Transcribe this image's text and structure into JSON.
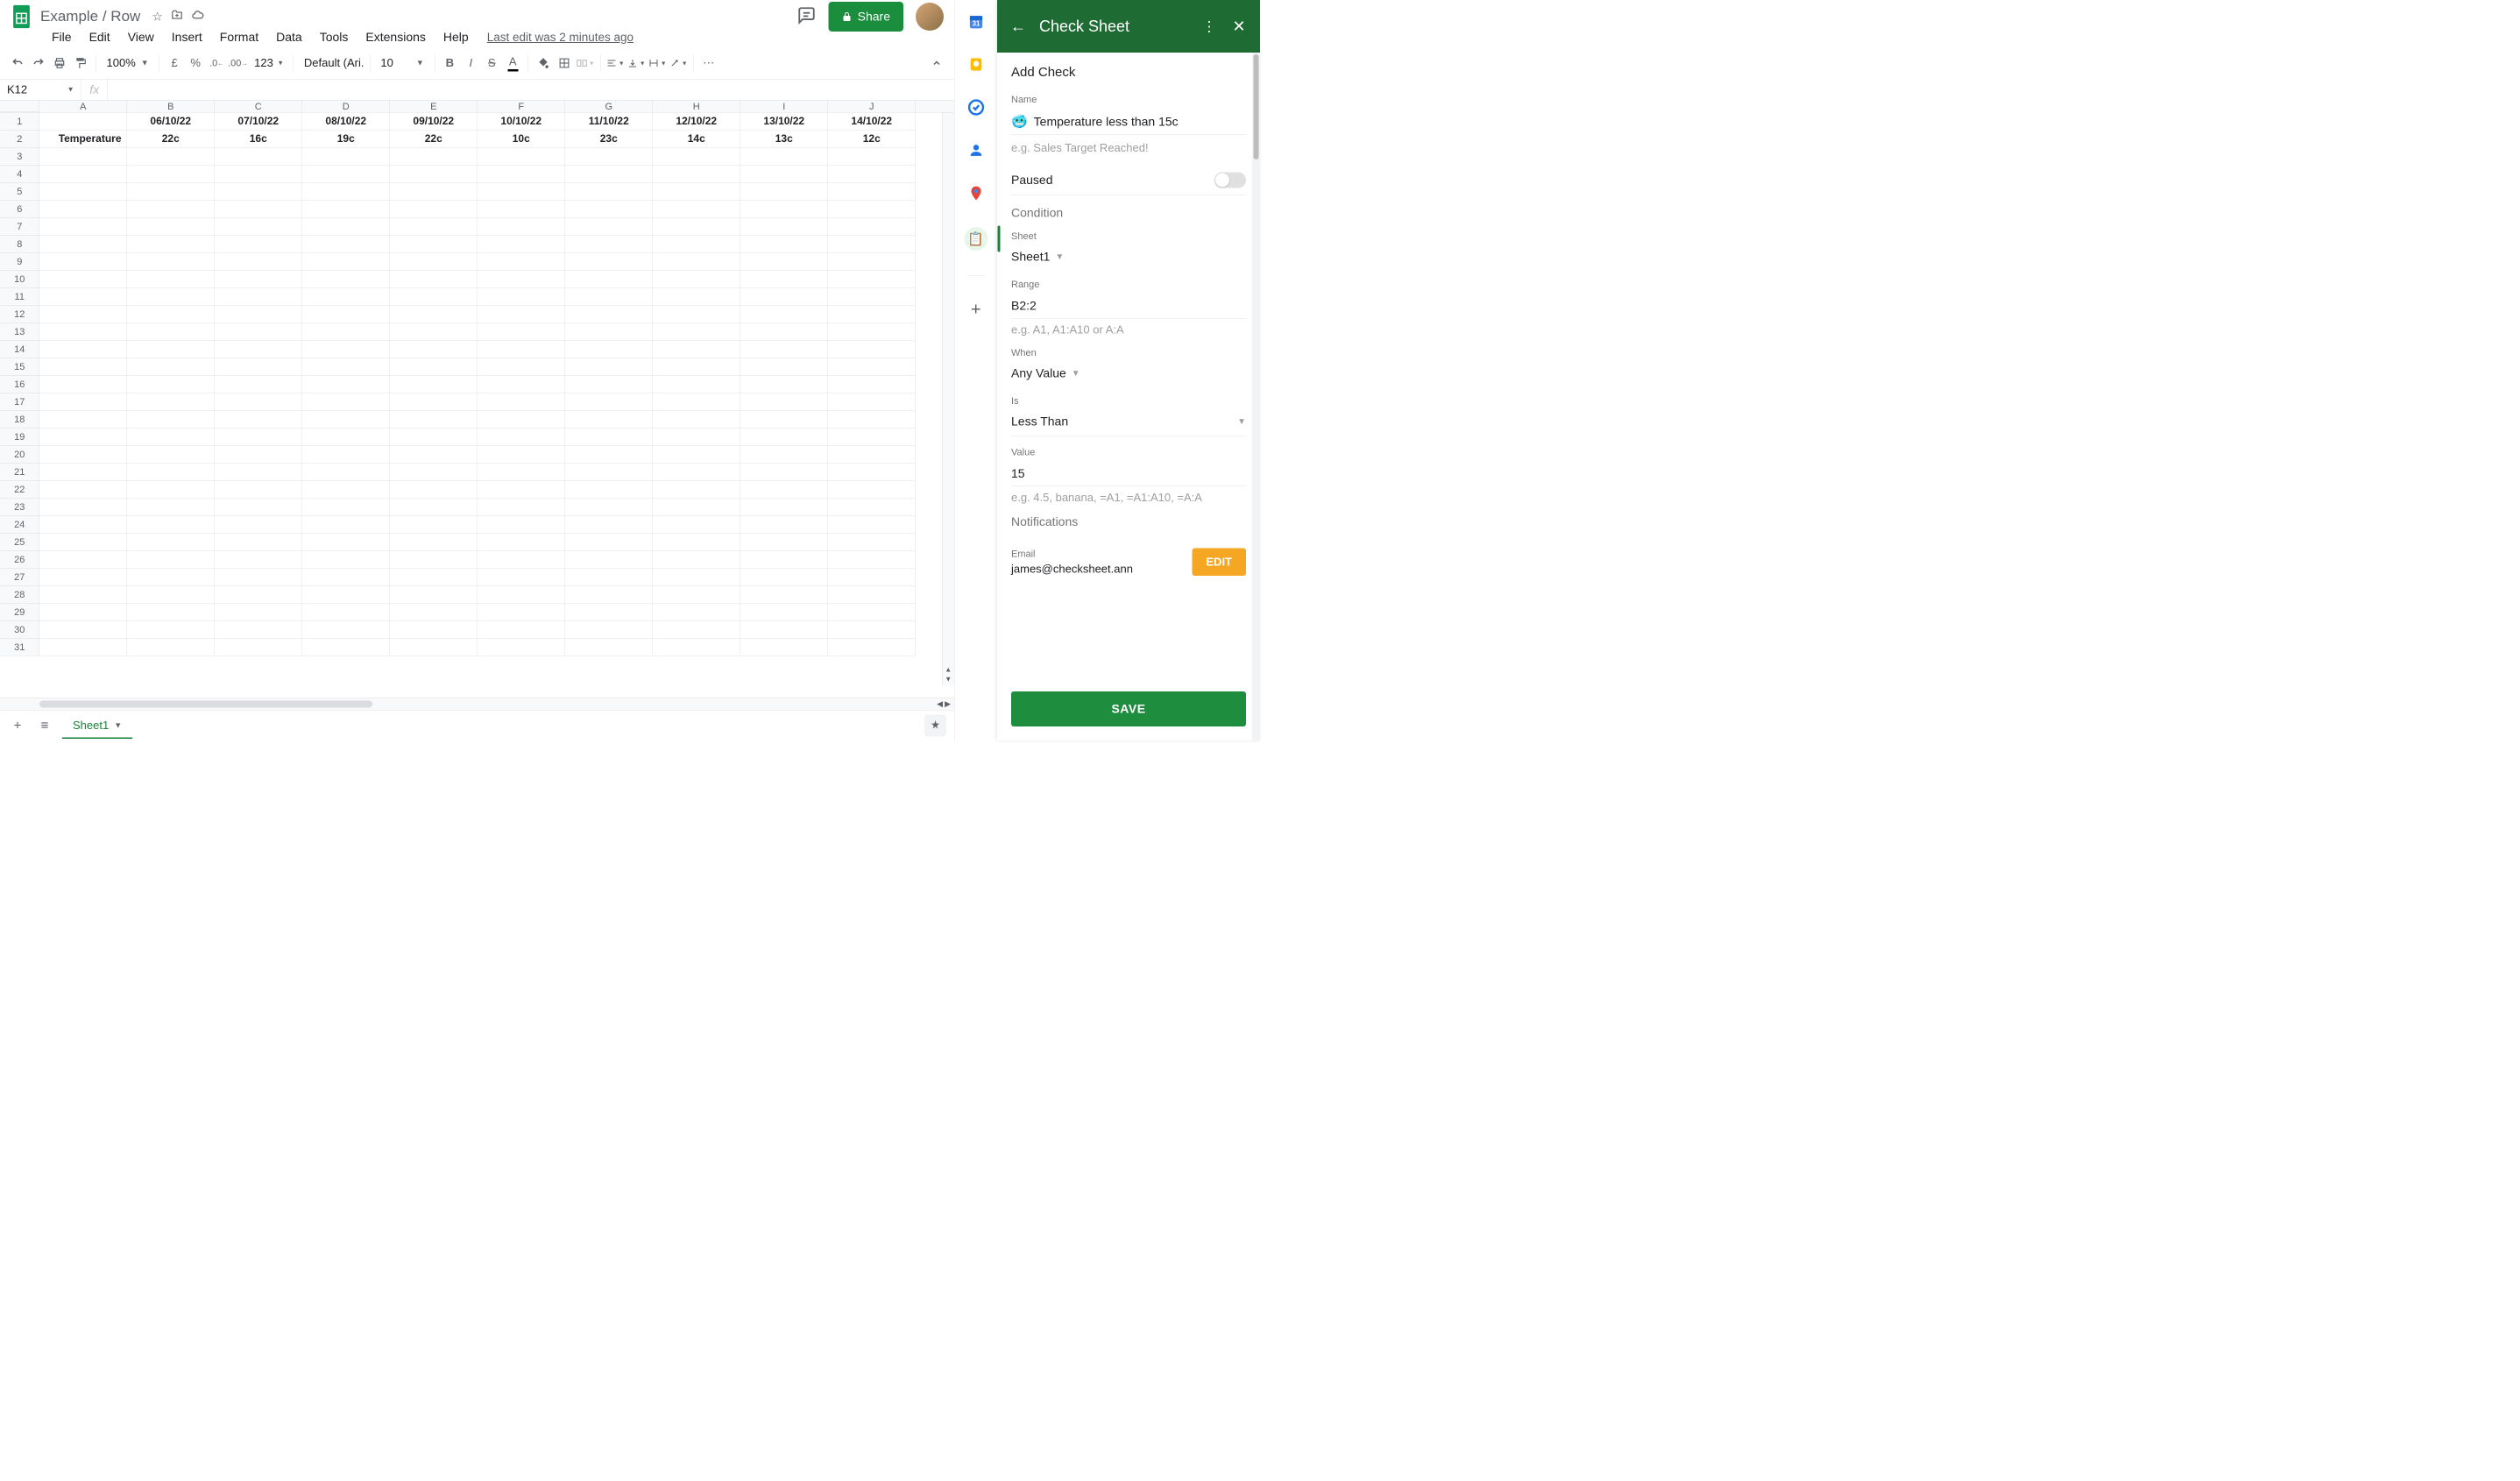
{
  "doc": {
    "title": "Example / Row",
    "last_edit": "Last edit was 2 minutes ago"
  },
  "menubar": [
    "File",
    "Edit",
    "View",
    "Insert",
    "Format",
    "Data",
    "Tools",
    "Extensions",
    "Help"
  ],
  "toolbar": {
    "zoom": "100%",
    "font": "Default (Ari...",
    "fontsize": "10",
    "currency": "£",
    "percent": "%",
    "dec_less": ".0",
    "dec_more": ".00",
    "num_format": "123"
  },
  "share_label": "Share",
  "namebox": "K12",
  "fx_value": "",
  "columns": [
    "A",
    "B",
    "C",
    "D",
    "E",
    "F",
    "G",
    "H",
    "I",
    "J"
  ],
  "rows": 31,
  "sheet_data": {
    "row1": [
      "",
      "06/10/22",
      "07/10/22",
      "08/10/22",
      "09/10/22",
      "10/10/22",
      "11/10/22",
      "12/10/22",
      "13/10/22",
      "14/10/22"
    ],
    "row2": [
      "Temperature",
      "22c",
      "16c",
      "19c",
      "22c",
      "10c",
      "23c",
      "14c",
      "13c",
      "12c"
    ]
  },
  "sheet_tab": "Sheet1",
  "checksheet": {
    "title": "Check Sheet",
    "add_check": "Add Check",
    "name_label": "Name",
    "name_emoji": "🥶",
    "name_value": "Temperature less than 15c",
    "name_hint": "e.g. Sales Target Reached!",
    "paused_label": "Paused",
    "condition_label": "Condition",
    "sheet_label": "Sheet",
    "sheet_value": "Sheet1",
    "range_label": "Range",
    "range_value": "B2:2",
    "range_hint": "e.g. A1, A1:A10 or A:A",
    "when_label": "When",
    "when_value": "Any Value",
    "is_label": "Is",
    "is_value": "Less Than",
    "value_label": "Value",
    "value_value": "15",
    "value_hint": "e.g. 4.5, banana, =A1, =A1:A10, =A:A",
    "notifications_label": "Notifications",
    "email_label": "Email",
    "email_value": "james@checksheet.ann",
    "edit_label": "EDIT",
    "save_label": "SAVE"
  }
}
